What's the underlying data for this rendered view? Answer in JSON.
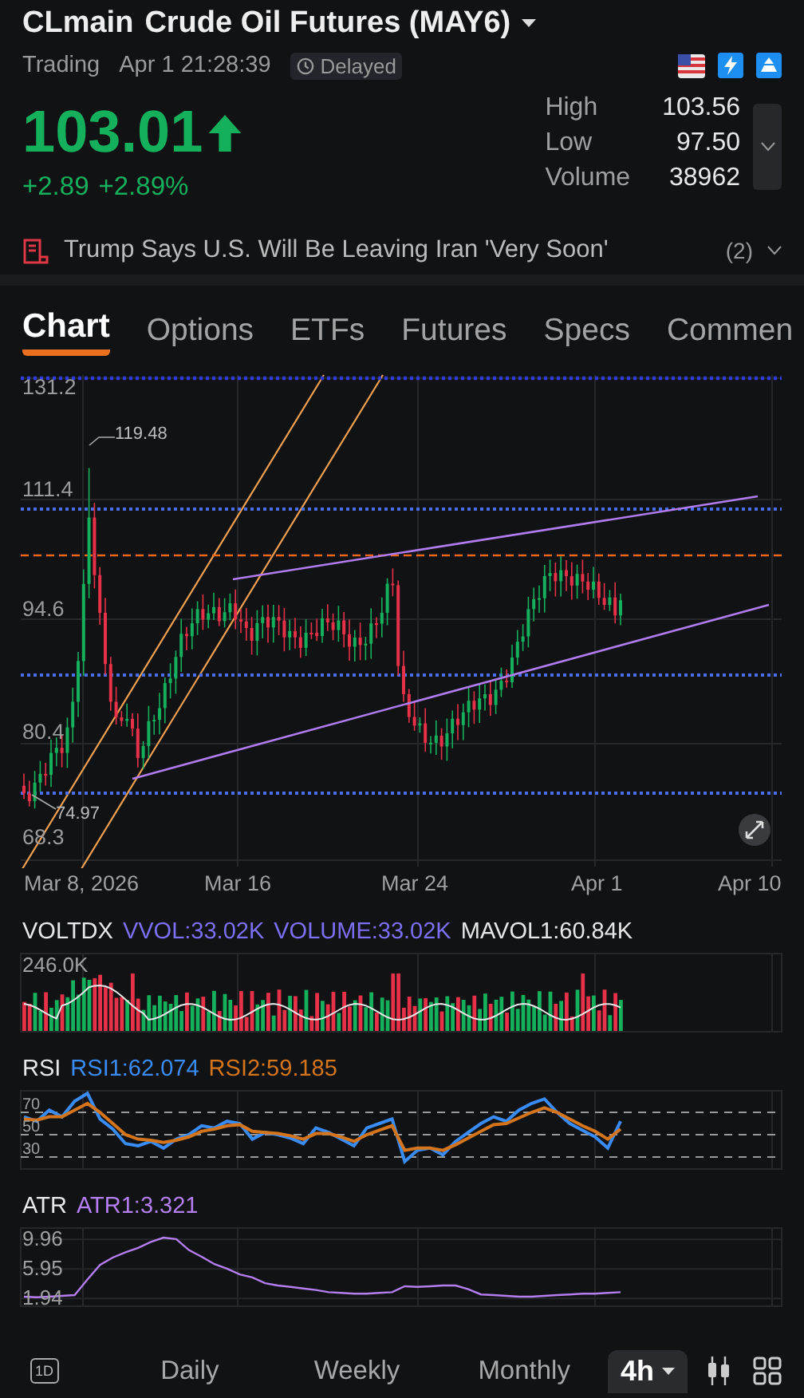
{
  "header": {
    "symbol": "CLmain",
    "name": "Crude Oil Futures (MAY6)",
    "status": "Trading",
    "time": "Apr 1 21:28:39",
    "delayed": "Delayed"
  },
  "quote": {
    "price": "103.01",
    "up": true,
    "change": "+2.89",
    "change_pct": "+2.89%",
    "stats": [
      {
        "label": "High",
        "value": "103.56"
      },
      {
        "label": "Low",
        "value": "97.50"
      },
      {
        "label": "Volume",
        "value": "38962"
      }
    ]
  },
  "news": {
    "headline": "Trump Says U.S. Will Be Leaving Iran 'Very Soon'",
    "count": "(2)"
  },
  "tabs": [
    {
      "label": "Chart",
      "selected": true
    },
    {
      "label": "Options",
      "selected": false
    },
    {
      "label": "ETFs",
      "selected": false
    },
    {
      "label": "Futures",
      "selected": false
    },
    {
      "label": "Specs",
      "selected": false
    },
    {
      "label": "Commen",
      "selected": false
    }
  ],
  "main_chart": {
    "y_labels": [
      "131.2",
      "111.4",
      "94.6",
      "80.4",
      "68.3"
    ],
    "x_labels": [
      "Mar 8, 2026",
      "Mar 16",
      "Mar 24",
      "Apr 1",
      "Apr 10"
    ],
    "high_label": "119.48",
    "low_label": "74.97"
  },
  "indicators": [
    {
      "kind": "volume",
      "name": "VOLTDX",
      "values": [
        {
          "text": "VVOL:33.02K",
          "color": "#7d6ff5"
        },
        {
          "text": "VOLUME:33.02K",
          "color": "#7d6ff5"
        },
        {
          "text": "MAVOL1:60.84K",
          "color": "#e6e6e6"
        }
      ],
      "scale_labels": [
        "246.0K"
      ]
    },
    {
      "kind": "rsi",
      "name": "RSI",
      "values": [
        {
          "text": "RSI1:62.074",
          "color": "#3a8cf5"
        },
        {
          "text": "RSI2:59.185",
          "color": "#d4751c"
        }
      ],
      "chart_data": {
        "type": "line",
        "yticks": [
          70,
          50,
          30
        ],
        "ylim": [
          20,
          90
        ],
        "grid": true,
        "series": [
          {
            "color": "#3a8cf5",
            "values": [
              66,
              62,
              72,
              66,
              80,
              87,
              64,
              55,
              42,
              40,
              44,
              38,
              46,
              50,
              58,
              56,
              62,
              60,
              46,
              52,
              50,
              47,
              42,
              56,
              52,
              46,
              40,
              56,
              60,
              64,
              26,
              36,
              38,
              32,
              44,
              52,
              60,
              66,
              62,
              72,
              78,
              82,
              70,
              60,
              54,
              48,
              38,
              62
            ]
          },
          {
            "color": "#d4751c",
            "values": [
              64,
              63,
              66,
              66,
              72,
              78,
              70,
              60,
              50,
              46,
              45,
              43,
              45,
              48,
              53,
              55,
              58,
              59,
              53,
              52,
              51,
              49,
              46,
              51,
              51,
              48,
              44,
              50,
              54,
              58,
              36,
              38,
              38,
              36,
              41,
              47,
              53,
              59,
              60,
              65,
              70,
              74,
              70,
              64,
              58,
              53,
              46,
              55
            ]
          }
        ]
      }
    },
    {
      "kind": "atr",
      "name": "ATR",
      "values": [
        {
          "text": "ATR1:3.321",
          "color": "#b57ef0"
        }
      ],
      "chart_data": {
        "type": "line",
        "yticks": [
          9.96,
          5.95,
          1.94
        ],
        "ylim": [
          1,
          11.6
        ],
        "grid": true,
        "series": [
          {
            "color": "#b57ef0",
            "values": [
              2.2,
              2.1,
              2.2,
              2.3,
              2.4,
              4.5,
              6.5,
              7.5,
              8.2,
              8.8,
              9.6,
              10.2,
              10,
              8.5,
              7.6,
              6.6,
              6.0,
              5.2,
              4.8,
              4.0,
              3.7,
              3.5,
              3.3,
              3.1,
              2.8,
              2.7,
              2.6,
              2.6,
              2.7,
              2.8,
              3.6,
              3.5,
              3.6,
              3.7,
              3.7,
              3.2,
              2.5,
              2.4,
              2.3,
              2.2,
              2.2,
              2.3,
              2.4,
              2.5,
              2.6,
              2.6,
              2.7,
              2.8
            ]
          }
        ]
      }
    }
  ],
  "periods": {
    "day_toggle": "1D",
    "items": [
      {
        "label": "Daily",
        "selected": false,
        "dropdown": false
      },
      {
        "label": "Weekly",
        "selected": false,
        "dropdown": false
      },
      {
        "label": "Monthly",
        "selected": false,
        "dropdown": false
      },
      {
        "label": "4h",
        "selected": true,
        "dropdown": true
      }
    ]
  }
}
